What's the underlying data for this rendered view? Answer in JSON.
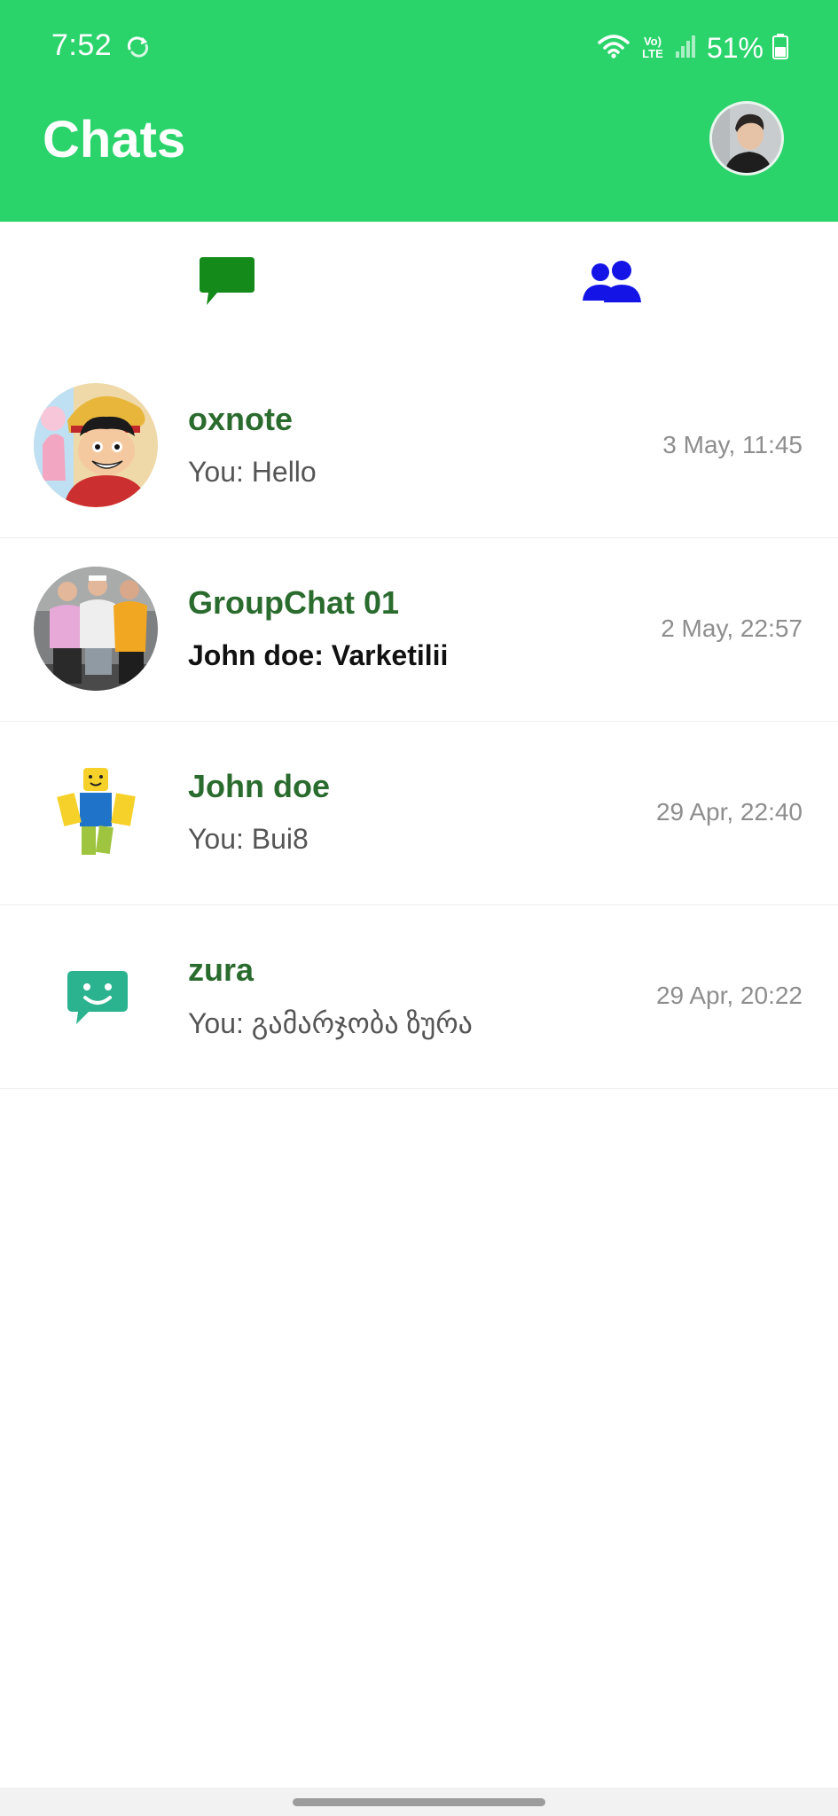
{
  "status_bar": {
    "time": "7:52",
    "network_label": "Vo) LTE",
    "battery": "51%",
    "icons": [
      "sync-icon",
      "wifi-icon",
      "volte-icon",
      "signal-icon",
      "battery-icon"
    ]
  },
  "header": {
    "title": "Chats",
    "profile_avatar_icon": "user-avatar"
  },
  "tabs": [
    {
      "name": "chats",
      "icon": "chat-bubble-icon",
      "color": "#138a1a",
      "active": true
    },
    {
      "name": "users",
      "icon": "people-icon",
      "color": "#1414e6",
      "active": false
    }
  ],
  "chats": [
    {
      "name": "oxnote",
      "preview": "You: Hello",
      "time": "3 May, 11:45",
      "unread": false,
      "avatar": "anime-character-avatar"
    },
    {
      "name": "GroupChat 01",
      "preview": "John doe: Varketilii",
      "time": "2 May, 22:57",
      "unread": true,
      "avatar": "group-photo-avatar"
    },
    {
      "name": "John doe",
      "preview": "You: Bui8",
      "time": "29 Apr, 22:40",
      "unread": false,
      "avatar": "blocky-figure-avatar"
    },
    {
      "name": "zura",
      "preview": "You: გამარჯობა ზურა",
      "time": "29 Apr, 20:22",
      "unread": false,
      "avatar": "smiley-chat-avatar"
    }
  ],
  "colors": {
    "header_bg": "#2bd46b",
    "name_color": "#2a6b2e",
    "time_color": "#8e8e8e"
  }
}
